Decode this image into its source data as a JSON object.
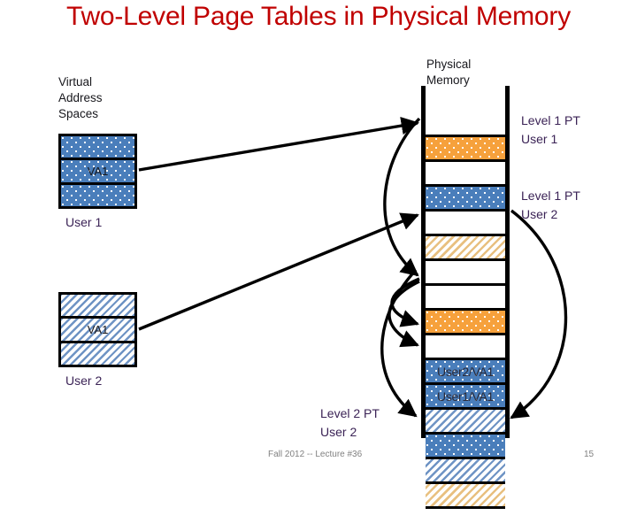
{
  "slide": {
    "title": "Two-Level Page Tables in Physical Memory",
    "footer_text": "Fall 2012 -- Lecture #36",
    "footer_page": "15"
  },
  "colors": {
    "title": "#C00000",
    "label_purple": "#3B2356",
    "block_orange": "#F6A13C",
    "block_blue": "#4A7EBB",
    "block_blue_hatch": "#6E93C4",
    "block_tan_hatch": "#E8C080",
    "outline": "#000000",
    "footer": "#808080"
  },
  "labels": {
    "virtual_address_spaces": "Virtual\nAddress\nSpaces",
    "physical_memory": "Physical\nMemory",
    "user1": "User 1",
    "user2": "User 2",
    "level1_pt_user1": "Level 1 PT\nUser 1",
    "level1_pt_user2": "Level 1 PT\nUser 2",
    "level2_pt_user2": "Level 2 PT\nUser 2"
  },
  "virtual_address_spaces": [
    {
      "owner": "User 1",
      "fill": "blue-dot",
      "cells": [
        {
          "label": ""
        },
        {
          "label": "VA1"
        },
        {
          "label": ""
        }
      ]
    },
    {
      "owner": "User 2",
      "fill": "blue-hatch",
      "cells": [
        {
          "label": ""
        },
        {
          "label": "VA1"
        },
        {
          "label": ""
        }
      ]
    }
  ],
  "physical_memory": {
    "heading": "Physical\nMemory",
    "rows": [
      {
        "index": 0,
        "fill": "white",
        "label": ""
      },
      {
        "index": 1,
        "fill": "orange-dot",
        "label": ""
      },
      {
        "index": 2,
        "fill": "white",
        "label": ""
      },
      {
        "index": 3,
        "fill": "blue-dot",
        "label": ""
      },
      {
        "index": 4,
        "fill": "white",
        "label": ""
      },
      {
        "index": 5,
        "fill": "tan-hatch",
        "label": ""
      },
      {
        "index": 6,
        "fill": "white",
        "label": ""
      },
      {
        "index": 7,
        "fill": "white",
        "label": ""
      },
      {
        "index": 8,
        "fill": "orange-dot",
        "label": ""
      },
      {
        "index": 9,
        "fill": "white",
        "label": ""
      },
      {
        "index": 10,
        "fill": "blue-dot",
        "label": "User2/VA1"
      },
      {
        "index": 11,
        "fill": "blue-dot",
        "label": "User1/VA1"
      },
      {
        "index": 12,
        "fill": "blue-hatch",
        "label": ""
      },
      {
        "index": 13,
        "fill": "blue-dot",
        "label": ""
      },
      {
        "index": 14,
        "fill": "blue-hatch",
        "label": ""
      },
      {
        "index": 15,
        "fill": "tan-hatch",
        "label": ""
      },
      {
        "index": 16,
        "fill": "white",
        "label": ""
      }
    ]
  },
  "connectors": [
    {
      "from": "user1-va1",
      "to": "pm-row-1",
      "style": "straight-arrow"
    },
    {
      "from": "user2-va1",
      "to": "pm-row-5",
      "style": "straight-arrow"
    },
    {
      "from": "pm-row-1",
      "to": "pm-row-8",
      "style": "curve-left"
    },
    {
      "from": "pm-row-8",
      "to": "pm-row-10",
      "style": "curve-left"
    },
    {
      "from": "pm-row-8",
      "to": "pm-row-11",
      "style": "curve-left"
    },
    {
      "from": "pm-row-5",
      "to": "pm-row-15",
      "style": "curve-right"
    }
  ]
}
